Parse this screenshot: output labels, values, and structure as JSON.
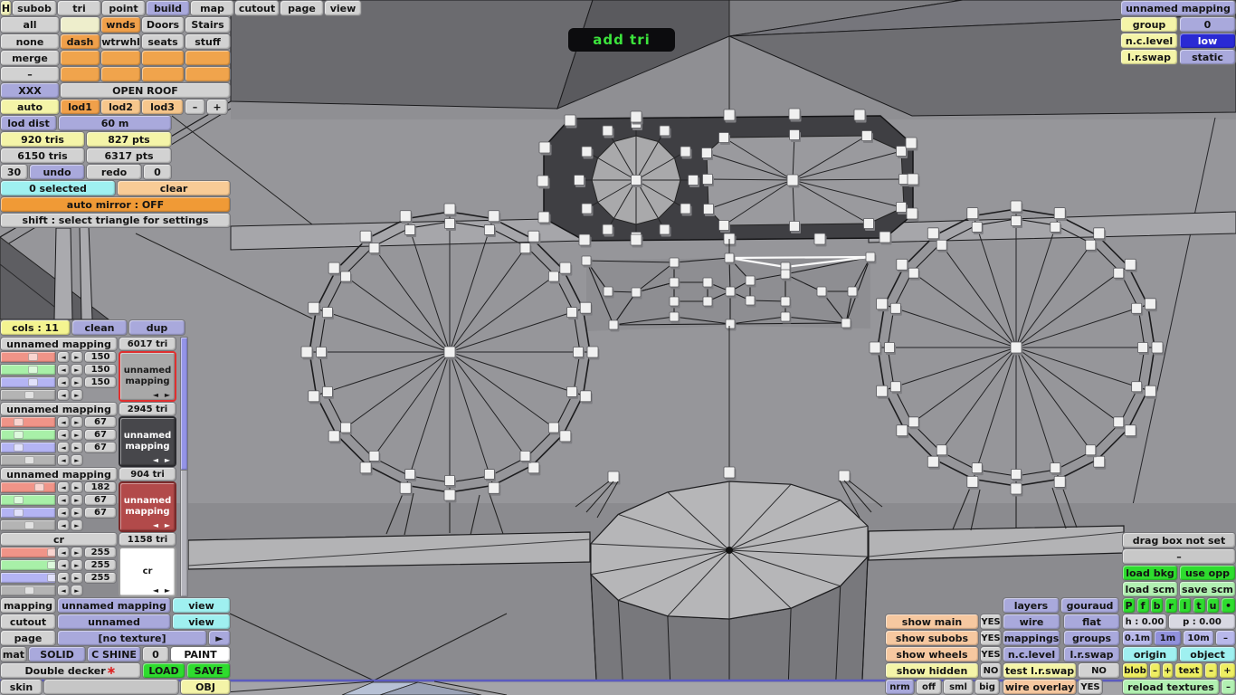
{
  "colors": {
    "gray": "#d2d2d2",
    "gray_dim": "#c6c6c6",
    "gray_dark": "#bcbcbe",
    "lavender": "#a9a9dc",
    "lavender_light": "#b8b8ea",
    "lavender_dark": "#9191dc",
    "cream": "#eeeecc",
    "pale_yellow": "#f4f4a8",
    "bright_yellow": "#f4f490",
    "sat_yellow": "#eeee62",
    "orange": "#f0a04a",
    "orange_light": "#f6c68c",
    "orange_strong": "#f09a36",
    "peach": "#f6c8a0",
    "peach_light": "#f8cb96",
    "cyan": "#9ff0f0",
    "green": "#2edc2e",
    "green_pale": "#b2f0b2",
    "blue": "#2a2ad4",
    "white": "#ffffff",
    "track_red": "#f09488",
    "track_green": "#a8f0a8",
    "track_blue": "#b4b4f4",
    "track_gray": "#b4b4b4",
    "add_tri_green": "#3ce43c",
    "hp_gray": "#d8d8e2"
  },
  "menu": {
    "items": [
      "H",
      "subob",
      "tri",
      "point",
      "build",
      "map",
      "cutout",
      "page",
      "view"
    ]
  },
  "tools": {
    "row2": [
      "all",
      "",
      "wnds",
      "Doors",
      "Stairs"
    ],
    "row3": [
      "none",
      "dash",
      "wtrwhl",
      "seats",
      "stuff"
    ],
    "merge": "merge",
    "dash": "–",
    "xxx": "XXX",
    "open_roof": "OPEN ROOF"
  },
  "lod": {
    "auto": "auto",
    "levels": [
      "lod1",
      "lod2",
      "lod3"
    ],
    "minus": "–",
    "plus": "+",
    "dist_label": "lod dist",
    "dist_value": "60 m"
  },
  "stats": {
    "sel_tris": "920 tris",
    "sel_pts": "827 pts",
    "total_tris": "6150 tris",
    "total_pts": "6317 pts",
    "undo_count": "30",
    "undo": "undo",
    "redo": "redo",
    "redo_count": "0"
  },
  "selection": {
    "count": "0 selected",
    "clear": "clear",
    "auto_mirror": "auto mirror : OFF",
    "hint": "shift : select triangle for settings"
  },
  "viewport": {
    "add_tri": "add tri"
  },
  "colors_panel": {
    "title": "cols : 11",
    "clean": "clean",
    "dup": "dup",
    "arrow_left": "◄",
    "arrow_right": "►",
    "groups": [
      {
        "name": "unnamed mapping",
        "tris": "6017 tri",
        "values": [
          "150",
          "150",
          "150"
        ],
        "swatch_label": "unnamed mapping",
        "swatch_bg": "#a8a8a8",
        "swatch_fg": "#1a1a1a",
        "swatch_border": "#e03030"
      },
      {
        "name": "unnamed mapping",
        "tris": "2945 tri",
        "values": [
          "67",
          "67",
          "67"
        ],
        "swatch_label": "unnamed mapping",
        "swatch_bg": "#47474b",
        "swatch_fg": "#ffffff",
        "swatch_border": "#2a2a2e"
      },
      {
        "name": "unnamed mapping",
        "tris": "904 tri",
        "values": [
          "182",
          "67",
          "67"
        ],
        "swatch_label": "unnamed mapping",
        "swatch_bg": "#b24a4a",
        "swatch_fg": "#ffffff",
        "swatch_border": "#7a2a2a"
      },
      {
        "name": "cr",
        "tris": "1158 tri",
        "values": [
          "255",
          "255",
          "255"
        ],
        "swatch_label": "cr",
        "swatch_bg": "#ffffff",
        "swatch_fg": "#1a1a1a",
        "swatch_border": "#9a9a9a"
      }
    ]
  },
  "texture_rows": {
    "mapping_label": "mapping",
    "mapping_value": "unnamed mapping",
    "mapping_view": "view",
    "cutout_label": "cutout",
    "cutout_value": "unnamed",
    "cutout_view": "view",
    "page_label": "page",
    "page_value": "[no texture]",
    "page_arrow": "►",
    "mat_label": "mat",
    "mat_solid": "SOLID",
    "mat_cshine": "C SHINE",
    "mat_zero": "0",
    "mat_paint": "PAINT",
    "model_name": "Double decker",
    "model_star": "∗",
    "load": "LOAD",
    "save": "SAVE",
    "skin": "skin",
    "obj": "OBJ"
  },
  "top_right": {
    "title": "unnamed mapping",
    "group_label": "group",
    "group_value": "0",
    "nc_label": "n.c.level",
    "nc_value": "low",
    "lr_label": "l.r.swap",
    "lr_value": "static"
  },
  "drag_box": {
    "status": "drag box not set",
    "dash": "–",
    "load_bkg": "load bkg",
    "use_opp": "use opp",
    "load_scm": "load scm",
    "save_scm": "save scm"
  },
  "display": {
    "layers": "layers",
    "gouraud": "gouraud",
    "faces": [
      "P",
      "f",
      "b",
      "r",
      "l",
      "t",
      "u"
    ],
    "dot": "•",
    "show_main": "show main",
    "yes1": "YES",
    "wire": "wire",
    "flat": "flat",
    "h": "h : 0.00",
    "p": "p : 0.00",
    "show_subobs": "show subobs",
    "yes2": "YES",
    "mappings": "mappings",
    "groups": "groups",
    "m01": "0.1m",
    "m1": "1m",
    "m10": "10m",
    "dash1": "–",
    "show_wheels": "show wheels",
    "yes3": "YES",
    "nc": "n.c.level",
    "lr": "l.r.swap",
    "origin": "origin",
    "object": "object",
    "show_hidden": "show hidden",
    "no1": "NO",
    "test_lr": "test l.r.swap",
    "no2": "NO",
    "blob": "blob",
    "blob_minus": "–",
    "blob_plus": "+",
    "text": "text",
    "text_minus": "–",
    "text_plus": "+",
    "nrm": "nrm",
    "off": "off",
    "sml": "sml",
    "big": "big",
    "wire_overlay": "wire overlay",
    "yes4": "YES",
    "reload": "reload textures",
    "reload_minus": "–"
  }
}
